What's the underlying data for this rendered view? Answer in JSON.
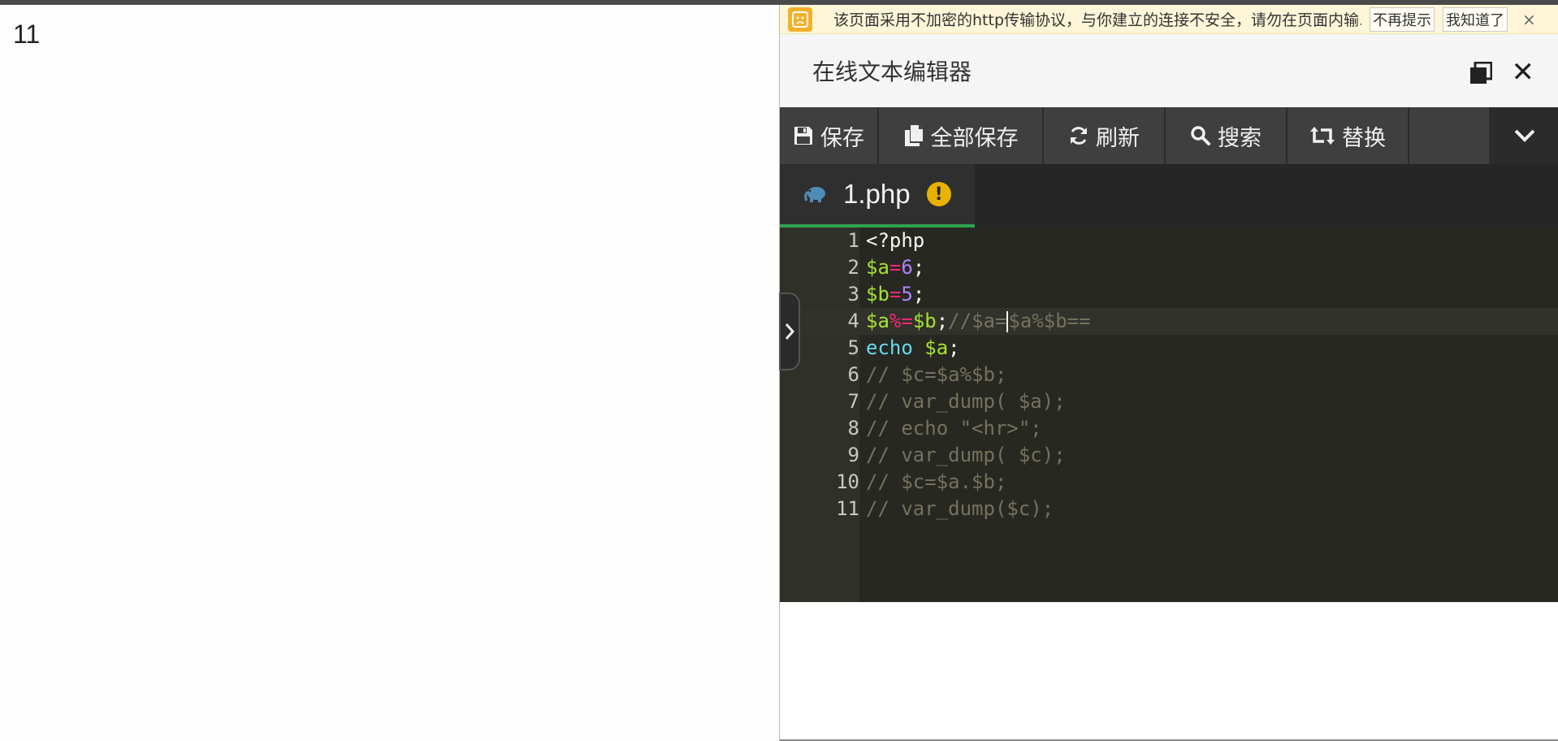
{
  "page": {
    "output_text": "11"
  },
  "notice": {
    "icon": "warning-face-icon",
    "text": "该页面采用不加密的http传输协议，与你建立的连接不安全，请勿在页面内输...",
    "no_remind_label": "不再提示",
    "got_it_label": "我知道了",
    "close_label": "×"
  },
  "editor_window": {
    "title": "在线文本编辑器",
    "close_label": "✕"
  },
  "toolbar": {
    "save_label": "保存",
    "save_all_label": "全部保存",
    "refresh_label": "刷新",
    "search_label": "搜索",
    "replace_label": "替换"
  },
  "tab": {
    "file_name": "1.php",
    "warn_label": "!"
  },
  "code": {
    "lines": [
      {
        "num": "1",
        "text": "<?php"
      },
      {
        "num": "2",
        "text": "$a=6;"
      },
      {
        "num": "3",
        "text": "$b=5;"
      },
      {
        "num": "4",
        "text": "$a%=$b;//$a=$a%$b=="
      },
      {
        "num": "5",
        "text": "echo $a;"
      },
      {
        "num": "6",
        "text": "// $c=$a%$b;"
      },
      {
        "num": "7",
        "text": "// var_dump( $a);"
      },
      {
        "num": "8",
        "text": "// echo \"<hr>\";"
      },
      {
        "num": "9",
        "text": "// var_dump( $c);"
      },
      {
        "num": "10",
        "text": "// $c=$a.$b;"
      },
      {
        "num": "11",
        "text": "// var_dump($c);"
      }
    ],
    "active_line": 4
  },
  "colors": {
    "accent_green": "#2ea44f",
    "variable": "#a6e22e",
    "number": "#ae81ff",
    "operator": "#f92672",
    "keyword": "#66d9ef",
    "comment": "#75715e"
  }
}
